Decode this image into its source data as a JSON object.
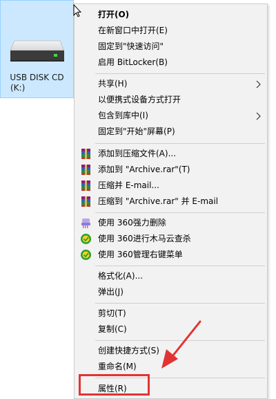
{
  "desktop": {
    "drive_name": "USB DISK CD",
    "drive_letter": "(K:)",
    "icon": "usb-drive-icon"
  },
  "menu": {
    "items": [
      {
        "label": "打开(O)",
        "bold": true
      },
      {
        "label": "在新窗口中打开(E)"
      },
      {
        "label": "固定到\"快速访问\""
      },
      {
        "label": "启用 BitLocker(B)"
      },
      {
        "label": "共享(H)",
        "submenu": true
      },
      {
        "label": "以便携式设备方式打开"
      },
      {
        "label": "包含到库中(I)",
        "submenu": true
      },
      {
        "label": "固定到\"开始\"屏幕(P)"
      },
      {
        "label": "添加到压缩文件(A)...",
        "icon": "winrar-icon"
      },
      {
        "label": "添加到 \"Archive.rar\"(T)",
        "icon": "winrar-icon"
      },
      {
        "label": "压缩并 E-mail...",
        "icon": "winrar-icon"
      },
      {
        "label": "压缩到 \"Archive.rar\" 并 E-mail",
        "icon": "winrar-icon"
      },
      {
        "label": "使用 360强力删除",
        "icon": "shredder-icon"
      },
      {
        "label": "使用 360进行木马云查杀",
        "icon": "360-shield-icon"
      },
      {
        "label": "使用 360管理右键菜单",
        "icon": "360-shield-icon"
      },
      {
        "label": "格式化(A)..."
      },
      {
        "label": "弹出(J)"
      },
      {
        "label": "剪切(T)"
      },
      {
        "label": "复制(C)"
      },
      {
        "label": "创建快捷方式(S)"
      },
      {
        "label": "重命名(M)"
      },
      {
        "label": "属性(R)"
      }
    ]
  },
  "annotation": {
    "highlight_color": "#e23333",
    "highlighted_item": "属性(R)"
  }
}
